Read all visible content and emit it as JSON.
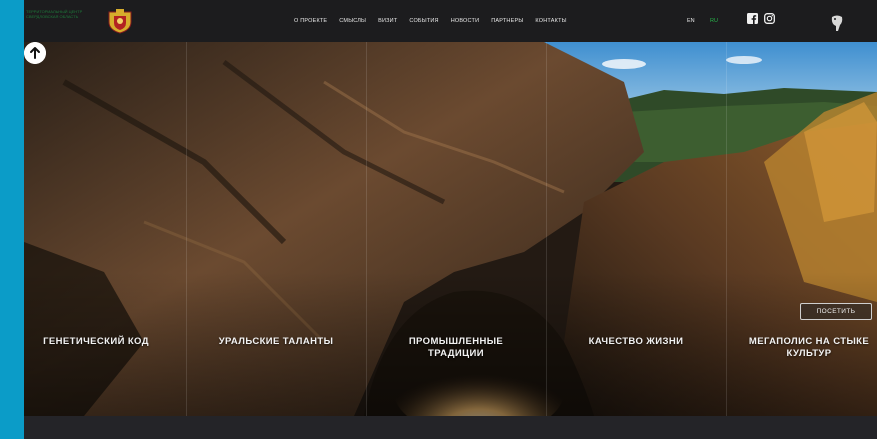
{
  "header": {
    "logo_text": "Территориальный центр Свердловская область",
    "nav": [
      "О проекте",
      "Смыслы",
      "Визит",
      "События",
      "Новости",
      "Партнеры",
      "Контакты"
    ],
    "lang_en": "EN",
    "lang_ru": "RU"
  },
  "hero": {
    "categories": [
      "Генетический код",
      "Уральские таланты",
      "Промышленные традиции",
      "Качество жизни",
      "Мегаполис на стыке культур"
    ],
    "visit_button": "Посетить"
  },
  "icons": {
    "social": [
      "facebook-icon",
      "instagram-icon"
    ],
    "scroll_up": "arrow-up-icon"
  },
  "colors": {
    "accent_strip": "#0b9cc8",
    "lang_active": "#27b24a",
    "header_bg": "#1c1c1e"
  }
}
